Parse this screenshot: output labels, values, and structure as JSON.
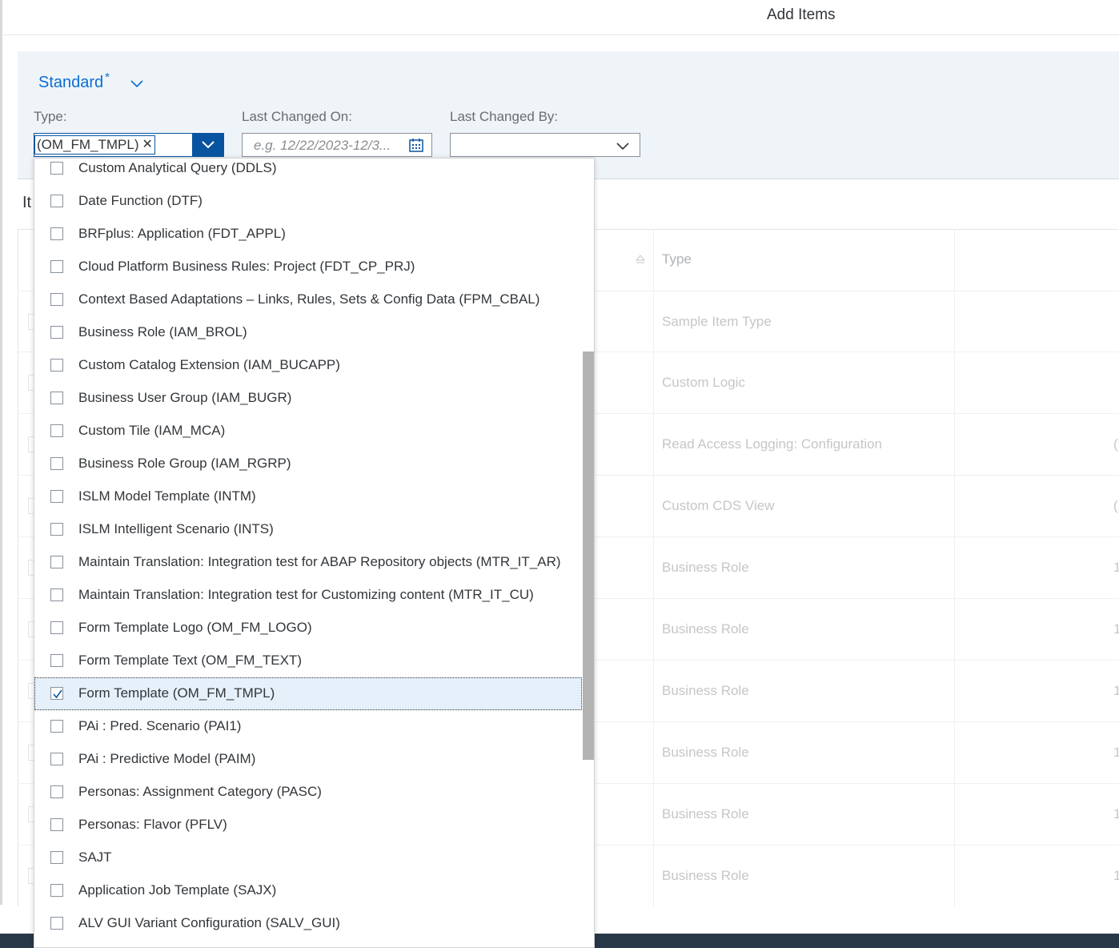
{
  "header": {
    "title": "Add Items"
  },
  "filterbar": {
    "variant": {
      "name": "Standard",
      "modified_marker": "*"
    },
    "type": {
      "label": "Type:",
      "token": "(OM_FM_TMPL)"
    },
    "last_changed_on": {
      "label": "Last Changed On:",
      "placeholder": "e.g. 12/22/2023-12/3..."
    },
    "last_changed_by": {
      "label": "Last Changed By:",
      "value": ""
    }
  },
  "table": {
    "title": "It",
    "column_type": "Type",
    "rows": [
      {
        "type": "Sample Item Type",
        "extra": ""
      },
      {
        "type": "Custom Logic",
        "extra": ""
      },
      {
        "type": "Read Access Logging: Configuration",
        "extra": "("
      },
      {
        "type": "Custom CDS View",
        "extra": "("
      },
      {
        "type": "Business Role",
        "extra": "1"
      },
      {
        "type": "Business Role",
        "extra": "1"
      },
      {
        "type": "Business Role",
        "extra": "1"
      },
      {
        "type": "Business Role",
        "extra": "1"
      },
      {
        "type": "Business Role",
        "extra": "1"
      },
      {
        "type": "Business Role",
        "extra": "1"
      }
    ]
  },
  "dropdown": {
    "items": [
      {
        "label": "Custom Analytical Query (DDLS)",
        "checked": false
      },
      {
        "label": "Date Function (DTF)",
        "checked": false
      },
      {
        "label": "BRFplus: Application (FDT_APPL)",
        "checked": false
      },
      {
        "label": "Cloud Platform Business Rules: Project (FDT_CP_PRJ)",
        "checked": false
      },
      {
        "label": "Context Based Adaptations – Links, Rules, Sets & Config Data (FPM_CBAL)",
        "checked": false
      },
      {
        "label": "Business Role (IAM_BROL)",
        "checked": false
      },
      {
        "label": "Custom Catalog Extension (IAM_BUCAPP)",
        "checked": false
      },
      {
        "label": "Business User Group (IAM_BUGR)",
        "checked": false
      },
      {
        "label": "Custom Tile (IAM_MCA)",
        "checked": false
      },
      {
        "label": "Business Role Group (IAM_RGRP)",
        "checked": false
      },
      {
        "label": "ISLM Model Template (INTM)",
        "checked": false
      },
      {
        "label": "ISLM Intelligent Scenario (INTS)",
        "checked": false
      },
      {
        "label": "Maintain Translation: Integration test for ABAP Repository objects (MTR_IT_AR)",
        "checked": false
      },
      {
        "label": "Maintain Translation: Integration test for Customizing content (MTR_IT_CU)",
        "checked": false
      },
      {
        "label": "Form Template Logo (OM_FM_LOGO)",
        "checked": false
      },
      {
        "label": "Form Template Text (OM_FM_TEXT)",
        "checked": false
      },
      {
        "label": "Form Template (OM_FM_TMPL)",
        "checked": true
      },
      {
        "label": "PAi : Pred. Scenario (PAI1)",
        "checked": false
      },
      {
        "label": "PAi : Predictive Model (PAIM)",
        "checked": false
      },
      {
        "label": "Personas: Assignment Category (PASC)",
        "checked": false
      },
      {
        "label": "Personas: Flavor (PFLV)",
        "checked": false
      },
      {
        "label": "SAJT",
        "checked": false
      },
      {
        "label": "Application Job Template (SAJX)",
        "checked": false
      },
      {
        "label": "ALV GUI Variant Configuration (SALV_GUI)",
        "checked": false
      }
    ]
  },
  "colors": {
    "accent": "#0854a0",
    "link": "#0a6ed1",
    "filterbar_bg": "#eff4f9",
    "selected_bg": "#e5f0fa"
  }
}
